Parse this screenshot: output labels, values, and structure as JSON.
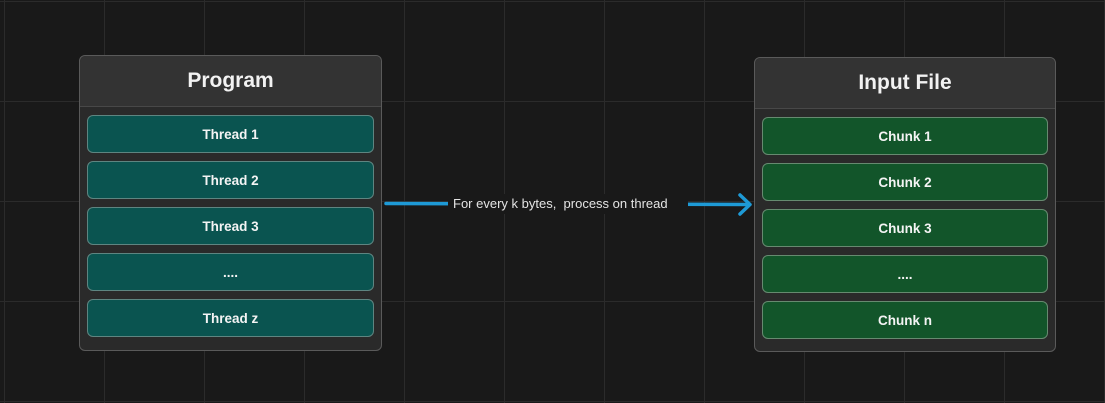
{
  "colors": {
    "background": "#191919",
    "grid": "#2b2b2b",
    "thread_fill": "#0a5450",
    "chunk_fill": "#12552a",
    "arrow": "#1e9ad6"
  },
  "program": {
    "title": "Program",
    "items": [
      {
        "label": "Thread 1"
      },
      {
        "label": "Thread 2"
      },
      {
        "label": "Thread 3"
      },
      {
        "label": "...."
      },
      {
        "label": "Thread z"
      }
    ]
  },
  "input_file": {
    "title": "Input File",
    "items": [
      {
        "label": "Chunk 1"
      },
      {
        "label": "Chunk 2"
      },
      {
        "label": "Chunk 3"
      },
      {
        "label": "...."
      },
      {
        "label": "Chunk n"
      }
    ]
  },
  "connector": {
    "label": "For every k bytes,  process on thread"
  }
}
